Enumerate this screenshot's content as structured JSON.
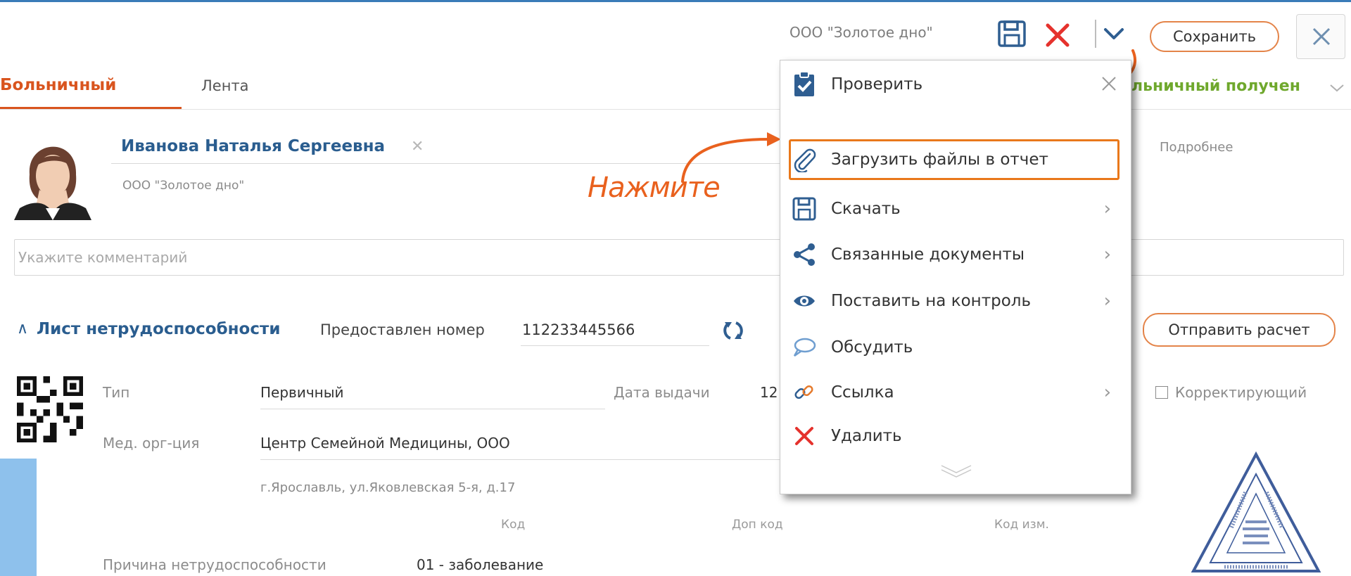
{
  "header": {
    "org_name": "ООО \"Золотое дно\"",
    "save_button": "Сохранить"
  },
  "tabs": [
    {
      "label": "Больничный",
      "active": true
    },
    {
      "label": "Лента",
      "active": false
    }
  ],
  "status": {
    "label_partial": "льничный получен"
  },
  "employee": {
    "name": "Иванова Наталья Сергеевна",
    "org": "ООО \"Золотое дно\"",
    "details_link": "Подробнее"
  },
  "comment": {
    "placeholder": "Укажите комментарий"
  },
  "sick_leave": {
    "section_title": "Лист нетрудоспособности",
    "number_label": "Предоставлен номер",
    "number_value": "112233445566",
    "send_button": "Отправить расчет",
    "type_label": "Тип",
    "type_value": "Первичный",
    "issue_date_label": "Дата выдачи",
    "issue_date_partial": "12",
    "corrective_label": "Корректирующий",
    "medorg_label": "Мед. орг-ция",
    "medorg_value": "Центр Семейной Медицины, ООО",
    "medorg_address": "г.Ярославль, ул.Яковлевская 5-я, д.17",
    "code_label": "Код",
    "extra_code_label": "Доп код",
    "changed_code_label": "Код изм.",
    "reason_label": "Причина нетрудоспособности",
    "reason_value": "01 - заболевание"
  },
  "menu": {
    "items": [
      {
        "label": "Проверить",
        "icon": "clipboard-check-icon"
      },
      {
        "label": "Загрузить файлы в отчет",
        "icon": "paperclip-icon"
      },
      {
        "label": "Скачать",
        "icon": "floppy-icon"
      },
      {
        "label": "Связанные документы",
        "icon": "share-icon"
      },
      {
        "label": "Поставить на контроль",
        "icon": "eye-icon"
      },
      {
        "label": "Обсудить",
        "icon": "speech-bubble-icon"
      },
      {
        "label": "Ссылка",
        "icon": "link-icon"
      },
      {
        "label": "Удалить",
        "icon": "delete-x-icon"
      }
    ]
  },
  "annotation": {
    "text": "Нажмите"
  },
  "colors": {
    "accent_orange": "#d9541e",
    "highlight_orange": "#e9781b",
    "link_blue": "#2a5d8f",
    "status_green": "#6fa82d",
    "delete_red": "#e5322d"
  }
}
